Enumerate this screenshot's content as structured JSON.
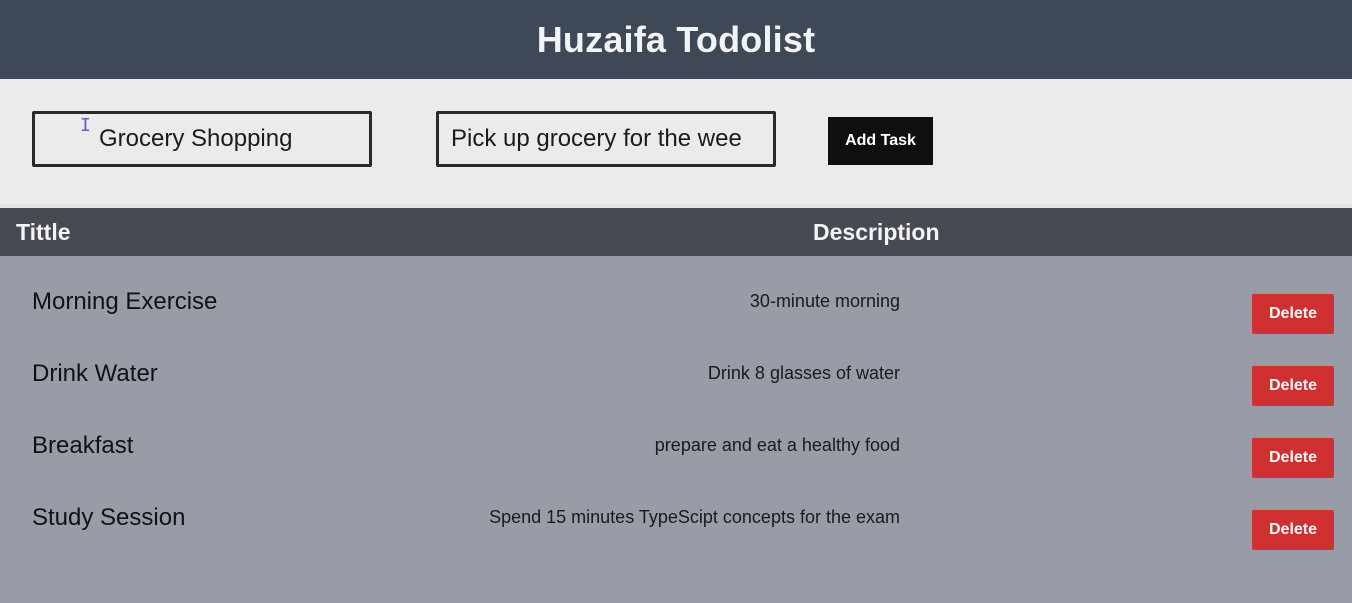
{
  "header": {
    "title": "Huzaifa Todolist"
  },
  "form": {
    "title_value": "Grocery Shopping",
    "description_value": "Pick up grocery for the wee",
    "add_button_label": "Add Task"
  },
  "table": {
    "columns": {
      "title": "Tittle",
      "description": "Description"
    },
    "rows": [
      {
        "title": "Morning Exercise",
        "description": "30-minute morning",
        "delete_label": "Delete"
      },
      {
        "title": "Drink Water",
        "description": "Drink 8 glasses of water",
        "delete_label": "Delete"
      },
      {
        "title": "Breakfast",
        "description": "prepare and eat a healthy food",
        "delete_label": "Delete"
      },
      {
        "title": "Study Session",
        "description": "Spend 15 minutes TypeScipt concepts for the exam",
        "delete_label": "Delete"
      }
    ]
  },
  "colors": {
    "header_bg": "#3f4856",
    "form_bg": "#ebebeb",
    "table_head_bg": "#474a52",
    "list_bg": "#979ca7",
    "add_button_bg": "#0f0f0f",
    "delete_button_bg": "#d0302f"
  }
}
